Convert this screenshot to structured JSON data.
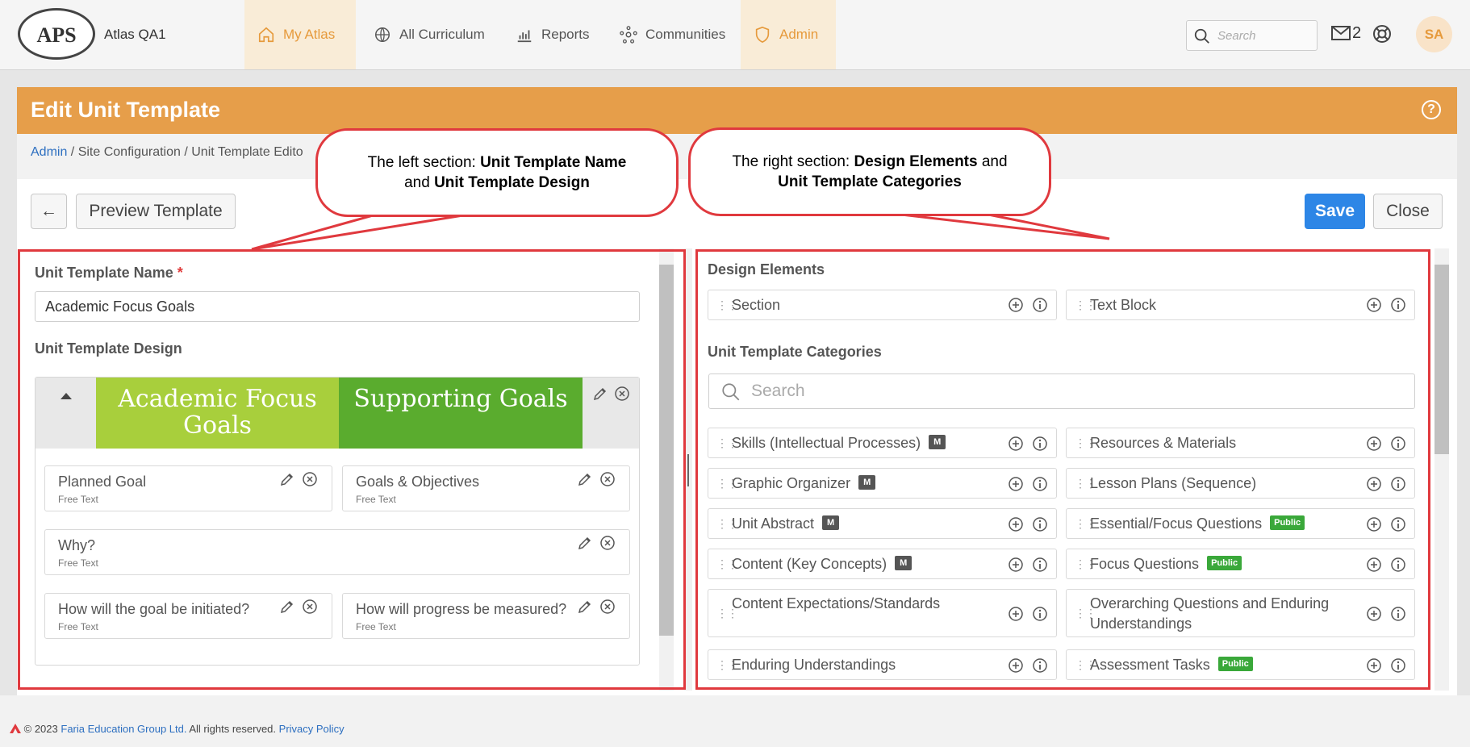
{
  "app": {
    "logo_text": "APS",
    "site_name": "Atlas QA1"
  },
  "nav": [
    {
      "label": "My Atlas",
      "icon": "home-icon",
      "active": true
    },
    {
      "label": "All Curriculum",
      "icon": "globe-icon",
      "active": false
    },
    {
      "label": "Reports",
      "icon": "bar-chart-icon",
      "active": false
    },
    {
      "label": "Communities",
      "icon": "network-icon",
      "active": false
    },
    {
      "label": "Admin",
      "icon": "shield-icon",
      "active": true
    }
  ],
  "topbar": {
    "search_placeholder": "Search",
    "mail_count": "2",
    "avatar_initials": "SA"
  },
  "page": {
    "title": "Edit Unit Template",
    "breadcrumb": [
      "Admin",
      "Site Configuration",
      "Unit Template Edito"
    ]
  },
  "toolbar": {
    "back_label": "←",
    "preview_label": "Preview Template",
    "save_label": "Save",
    "close_label": "Close"
  },
  "left": {
    "name_label": "Unit Template Name",
    "required_mark": "*",
    "name_value": "Academic Focus Goals",
    "design_label": "Unit Template Design",
    "tabs": [
      {
        "label": "Academic Focus Goals",
        "color": "#a8cf3c"
      },
      {
        "label": "Supporting Goals",
        "color": "#5aac2e"
      }
    ],
    "items": [
      {
        "title": "Planned Goal",
        "subtitle": "Free Text"
      },
      {
        "title": "Goals & Objectives",
        "subtitle": "Free Text"
      },
      {
        "title": "Why?",
        "subtitle": "Free Text"
      },
      {
        "title": "How will the goal be initiated?",
        "subtitle": "Free Text"
      },
      {
        "title": "How will progress be measured?",
        "subtitle": "Free Text"
      }
    ]
  },
  "right": {
    "design_elements_label": "Design Elements",
    "design_elements": [
      "Section",
      "Text Block"
    ],
    "categories_label": "Unit Template Categories",
    "search_placeholder": "Search",
    "categories": [
      {
        "name": "Skills (Intellectual Processes)",
        "badge": "M"
      },
      {
        "name": "Resources & Materials",
        "badge": ""
      },
      {
        "name": "Graphic Organizer",
        "badge": "M"
      },
      {
        "name": "Lesson Plans (Sequence)",
        "badge": ""
      },
      {
        "name": "Unit Abstract",
        "badge": "M"
      },
      {
        "name": "Essential/Focus Questions",
        "badge": "Public"
      },
      {
        "name": "Content (Key Concepts)",
        "badge": "M"
      },
      {
        "name": "Focus Questions",
        "badge": "Public"
      },
      {
        "name": "Content Expectations/Standards",
        "badge": ""
      },
      {
        "name": "Overarching Questions and Enduring Understandings",
        "badge": ""
      },
      {
        "name": "Enduring Understandings",
        "badge": ""
      },
      {
        "name": "Assessment Tasks",
        "badge": "Public"
      }
    ]
  },
  "callouts": {
    "left": {
      "pre": "The left section: ",
      "b1": "Unit Template Name",
      "mid": "and ",
      "b2": "Unit Template Design"
    },
    "right": {
      "pre": "The right section: ",
      "b1": "Design Elements",
      "mid": " and",
      "b2": "Unit Template Categories"
    }
  },
  "footer": {
    "copyright": "© 2023",
    "company": "Faria Education Group Ltd.",
    "rights": "All rights reserved.",
    "privacy": "Privacy Policy"
  },
  "colors": {
    "accent": "#e69e4a",
    "primary": "#2d86e6",
    "annotation": "#e0393e",
    "tab1": "#a8cf3c",
    "tab2": "#5aac2e"
  }
}
